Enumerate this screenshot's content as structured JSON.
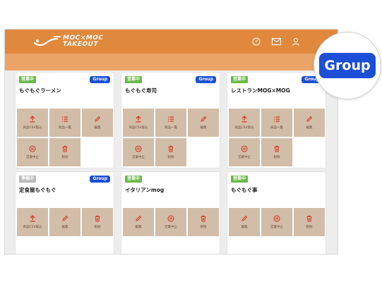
{
  "header": {
    "logo_line1": "MOC×MOC",
    "logo_line2": "TAKEOUT",
    "icons": [
      "help-icon",
      "mail-icon",
      "user-icon"
    ]
  },
  "colors": {
    "header": "#e0893d",
    "subbar": "#eaa468",
    "action_tile": "#d2bda8",
    "group_badge": "#1c4fd6",
    "status_open": "#6bb84a",
    "status_closed": "#b9b9b9",
    "action_icon": "#d23a2a"
  },
  "zoom": {
    "label": "Group"
  },
  "cards": [
    {
      "status": "営業中",
      "status_type": "open",
      "group": "Group",
      "name": "もぐもぐラーメン",
      "actions": [
        {
          "icon": "upload-icon",
          "label": "商品CSV取込"
        },
        {
          "icon": "list-icon",
          "label": "商品一覧"
        },
        {
          "icon": "pencil-icon",
          "label": "編集"
        },
        {
          "icon": "pause-icon",
          "label": "営業中止"
        },
        {
          "icon": "trash-icon",
          "label": "削除"
        }
      ]
    },
    {
      "status": "営業中",
      "status_type": "open",
      "group": "Group",
      "name": "もぐもぐ寿司",
      "actions": [
        {
          "icon": "upload-icon",
          "label": "商品CSV取込"
        },
        {
          "icon": "list-icon",
          "label": "商品一覧"
        },
        {
          "icon": "pencil-icon",
          "label": "編集"
        },
        {
          "icon": "pause-icon",
          "label": "営業中止"
        },
        {
          "icon": "trash-icon",
          "label": "削除"
        }
      ]
    },
    {
      "status": "営業中",
      "status_type": "open",
      "group": "Group",
      "name": "レストランMOG×MOG",
      "actions": [
        {
          "icon": "upload-icon",
          "label": "商品CSV取込"
        },
        {
          "icon": "list-icon",
          "label": "商品一覧"
        },
        {
          "icon": "pencil-icon",
          "label": "編集"
        },
        {
          "icon": "pause-icon",
          "label": "営業中止"
        },
        {
          "icon": "trash-icon",
          "label": "削除"
        }
      ]
    },
    {
      "status": "準備中",
      "status_type": "closed",
      "group": "Group",
      "name": "定食屋もぐもぐ",
      "actions": [
        {
          "icon": "upload-icon",
          "label": "商品CSV取込"
        },
        {
          "icon": "pencil-icon",
          "label": "編集"
        },
        {
          "icon": "trash-icon",
          "label": "削除"
        }
      ]
    },
    {
      "status": "営業中",
      "status_type": "open",
      "group": "",
      "name": "イタリアンmog",
      "actions": [
        {
          "icon": "pencil-icon",
          "label": "編集"
        },
        {
          "icon": "pause-icon",
          "label": "営業中止"
        },
        {
          "icon": "trash-icon",
          "label": "削除"
        }
      ]
    },
    {
      "status": "営業中",
      "status_type": "open",
      "group": "",
      "name": "もぐもぐ事",
      "actions": [
        {
          "icon": "pencil-icon",
          "label": "編集"
        },
        {
          "icon": "pause-icon",
          "label": "営業中止"
        },
        {
          "icon": "trash-icon",
          "label": "削除"
        }
      ]
    }
  ]
}
